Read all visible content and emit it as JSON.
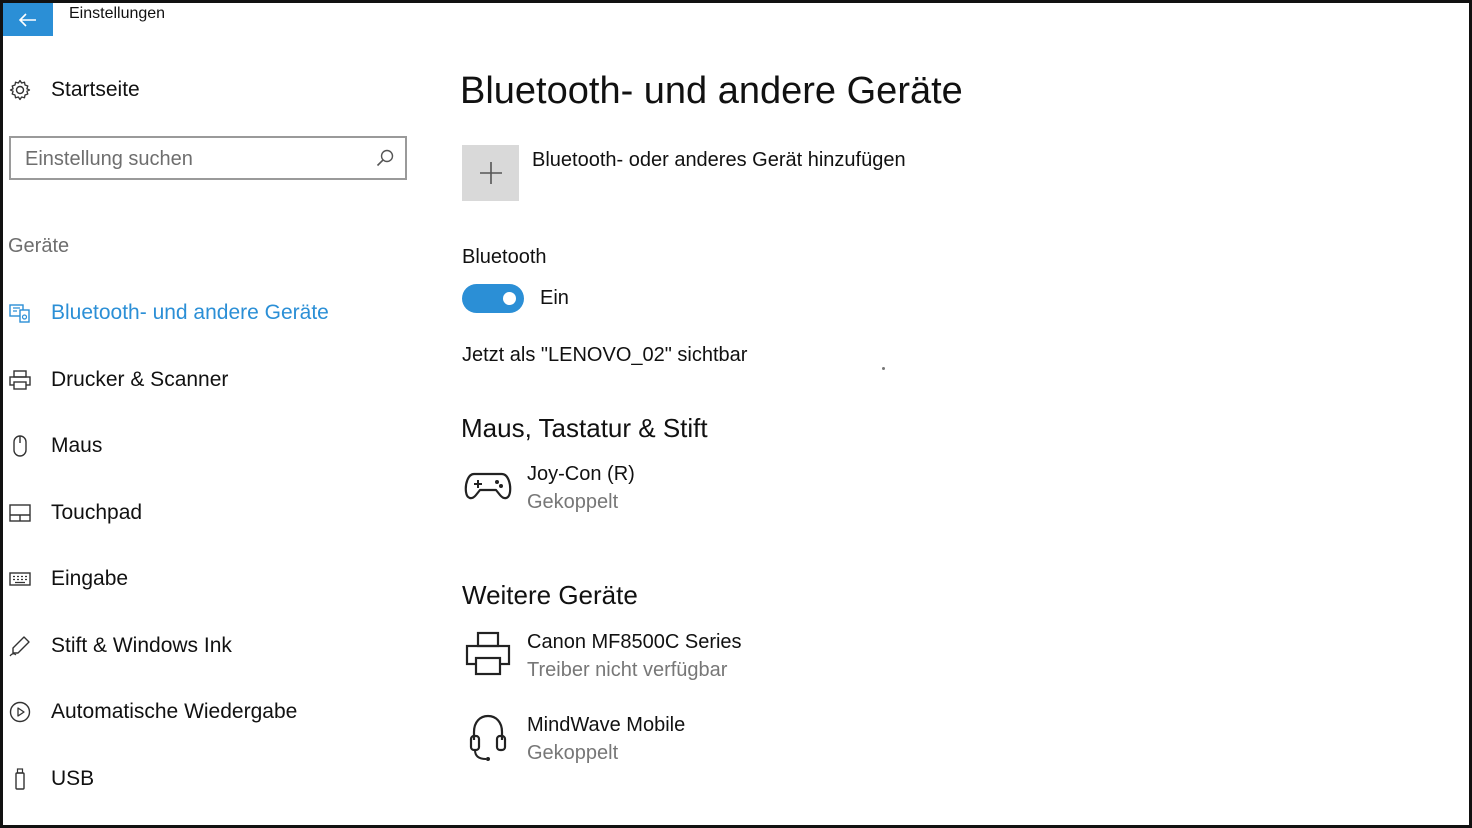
{
  "window": {
    "title": "Einstellungen"
  },
  "sidebar": {
    "home_label": "Startseite",
    "search_placeholder": "Einstellung suchen",
    "group_label": "Geräte",
    "items": [
      {
        "label": "Bluetooth- und andere Geräte",
        "icon": "bluetooth-devices-icon",
        "active": true
      },
      {
        "label": "Drucker & Scanner",
        "icon": "printer-icon",
        "active": false
      },
      {
        "label": "Maus",
        "icon": "mouse-icon",
        "active": false
      },
      {
        "label": "Touchpad",
        "icon": "touchpad-icon",
        "active": false
      },
      {
        "label": "Eingabe",
        "icon": "keyboard-icon",
        "active": false
      },
      {
        "label": "Stift & Windows Ink",
        "icon": "pen-icon",
        "active": false
      },
      {
        "label": "Automatische Wiedergabe",
        "icon": "autoplay-icon",
        "active": false
      },
      {
        "label": "USB",
        "icon": "usb-icon",
        "active": false
      }
    ]
  },
  "main": {
    "title": "Bluetooth- und andere Geräte",
    "add_device_label": "Bluetooth- oder anderes Gerät hinzufügen",
    "bluetooth": {
      "label": "Bluetooth",
      "state_label": "Ein",
      "enabled": true,
      "visibility_text": "Jetzt als \"LENOVO_02\" sichtbar"
    },
    "sections": [
      {
        "title": "Maus, Tastatur & Stift",
        "devices": [
          {
            "name": "Joy-Con (R)",
            "status": "Gekoppelt",
            "icon": "gamepad-icon"
          }
        ]
      },
      {
        "title": "Weitere Geräte",
        "devices": [
          {
            "name": "Canon MF8500C Series",
            "status": "Treiber nicht verfügbar",
            "icon": "printer-icon"
          },
          {
            "name": "MindWave Mobile",
            "status": "Gekoppelt",
            "icon": "headset-icon"
          }
        ]
      }
    ]
  },
  "colors": {
    "accent": "#2b8fd6",
    "secondary_text": "#777777",
    "tile": "#d9d9d9"
  }
}
